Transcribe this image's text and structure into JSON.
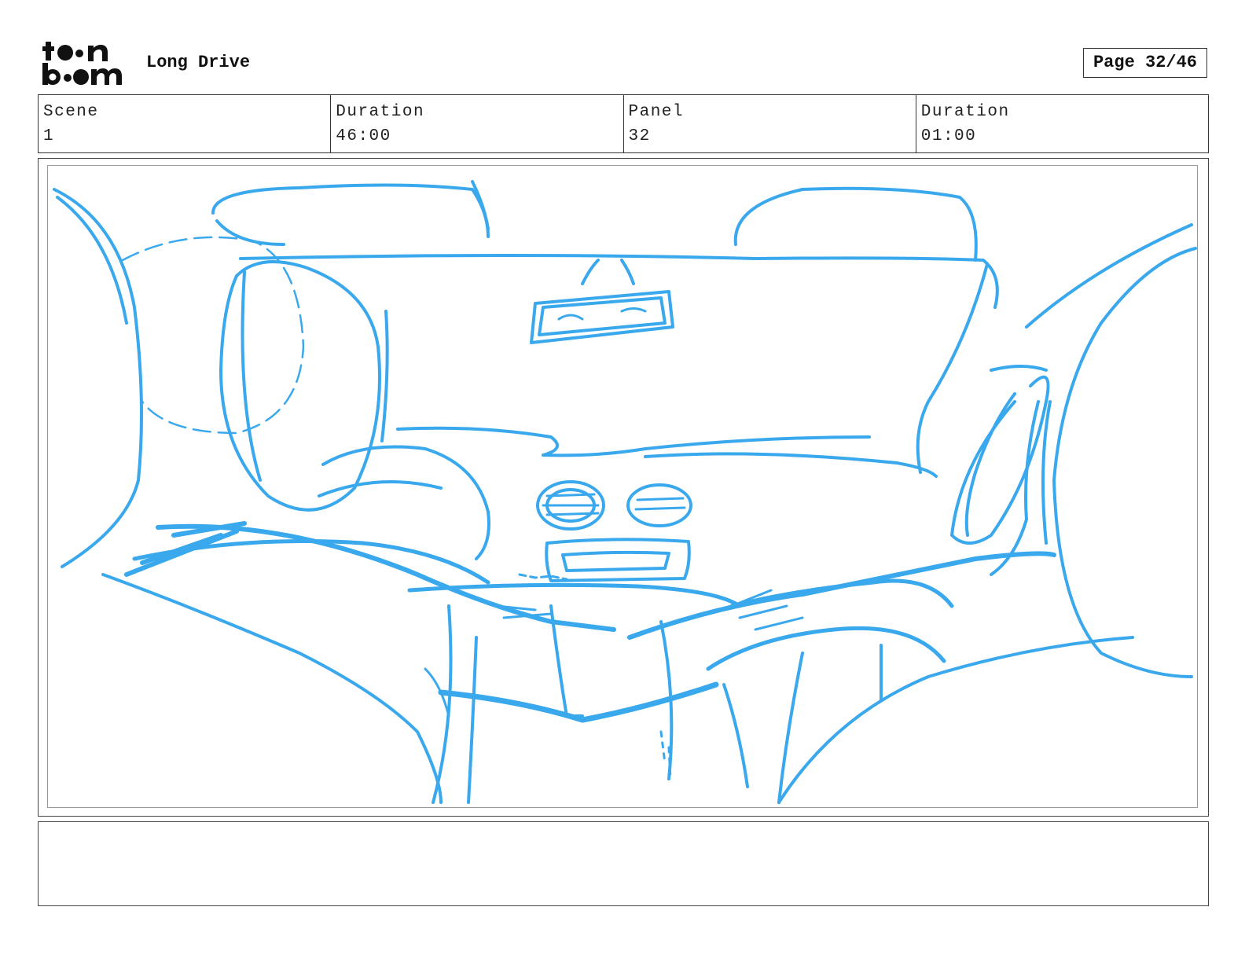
{
  "header": {
    "logo_line1": "to•n",
    "logo_line2": "b••m",
    "project_title": "Long Drive",
    "page_label": "Page 32/46"
  },
  "info": {
    "scene_label": "Scene",
    "scene_value": "1",
    "scene_duration_label": "Duration",
    "scene_duration_value": "46:00",
    "panel_label": "Panel",
    "panel_value": "32",
    "panel_duration_label": "Duration",
    "panel_duration_value": "01:00"
  },
  "panel": {
    "sketch_color": "#3aa8ec"
  },
  "notes": {
    "text": ""
  }
}
